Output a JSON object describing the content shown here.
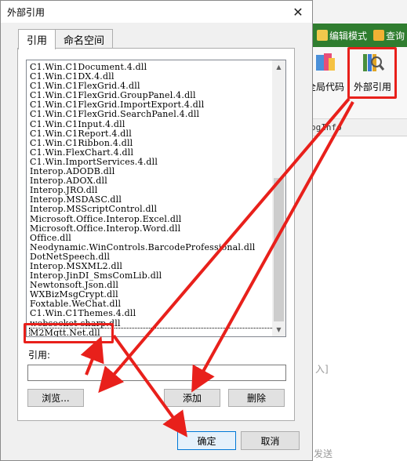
{
  "dialog": {
    "title": "外部引用",
    "close_glyph": "✕",
    "tabs": [
      {
        "label": "引用",
        "active": true
      },
      {
        "label": "命名空间",
        "active": false
      }
    ],
    "list_items": [
      "C1.Win.C1Document.4.dll",
      "C1.Win.C1DX.4.dll",
      "C1.Win.C1FlexGrid.4.dll",
      "C1.Win.C1FlexGrid.GroupPanel.4.dll",
      "C1.Win.C1FlexGrid.ImportExport.4.dll",
      "C1.Win.C1FlexGrid.SearchPanel.4.dll",
      "C1.Win.C1Input.4.dll",
      "C1.Win.C1Report.4.dll",
      "C1.Win.C1Ribbon.4.dll",
      "C1.Win.FlexChart.4.dll",
      "C1.Win.ImportServices.4.dll",
      "Interop.ADODB.dll",
      "Interop.ADOX.dll",
      "Interop.JRO.dll",
      "Interop.MSDASC.dll",
      "Interop.MSScriptControl.dll",
      "Microsoft.Office.Interop.Excel.dll",
      "Microsoft.Office.Interop.Word.dll",
      "Office.dll",
      "Neodynamic.WinControls.BarcodeProfessional.dll",
      "DotNetSpeech.dll",
      "Interop.MSXML2.dll",
      "Interop.JinDI_SmsComLib.dll",
      "Newtonsoft.Json.dll",
      "WXBizMsgCrypt.dll",
      "Foxtable.WeChat.dll",
      "C1.Win.C1Themes.4.dll",
      "websocket-sharp.dll",
      "M2Mqtt.Net.dll"
    ],
    "selected_item": "M2Mqtt.Net.dll",
    "reference_label": "引用:",
    "reference_value": "",
    "buttons": {
      "browse": "浏览...",
      "add": "添加",
      "delete": "删除",
      "ok": "确定",
      "cancel": "取消"
    }
  },
  "background_app": {
    "ribbon_buttons": [
      {
        "label": "编辑模式",
        "icon": "edit-icon"
      },
      {
        "label": "查询",
        "icon": "lock-icon"
      }
    ],
    "toolbar_items": [
      {
        "label": "全局代码",
        "icon": "global-code-icon"
      },
      {
        "label": "外部引用",
        "icon": "external-reference-icon"
      }
    ],
    "grid_header_fragment": "ogInfo",
    "input_fragment": "入]",
    "send_fragment": "发送"
  },
  "colors": {
    "annotation_red": "#e8201b",
    "ribbon_green": "#2f7d2f",
    "ok_button_border": "#0078d7"
  }
}
